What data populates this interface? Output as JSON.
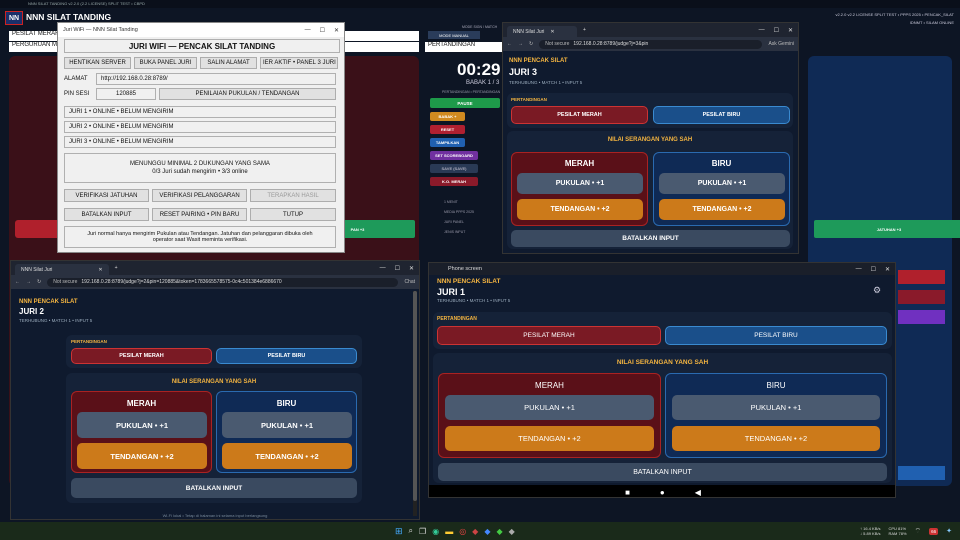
{
  "colors": {
    "red": "#7a1a24",
    "blue": "#1a4f8a",
    "orange": "#cc7a1a",
    "grey": "#4a5a70",
    "green": "#1e8a4a"
  },
  "bg": {
    "title": "NNN SILAT TANDING v2.2.0 (2.2 LICENSE) SPLIT TEST • CBPD",
    "top_right": "v2.2.0 v2.2 LICENSE SPLIT TEST • PPPS 2025 • PENCAK_SILAT",
    "top_right2": "IDNMT • SILAM ONLINE",
    "left_field1": "PESILAT MERAH",
    "left_field2": "PERGURUAN MERAH",
    "mid_field": "PERTANDINGAN",
    "mid_small": "MODE SIGN / MATCH",
    "mode_manual": "MODE MANUAL",
    "timer": "00:29",
    "babak": "BABAK 1 / 3",
    "pertandingan_lbl": "PERTANDINGAN • PERTANDINGAN",
    "btn_pause": "PAUSE",
    "btn_babak": "BABAK +",
    "btn_reset": "RESET",
    "btn_tampilkan": "TAMPILKAN",
    "btn_set_scoreboard": "SET SCOREBOARD",
    "btn_save": "SAVE (SAVE)",
    "btn_kmerah": "K.O. MERAH",
    "small1": "1 MENIT",
    "small2": "MEDIA PPPS 2025",
    "small3": "JURI PANEL",
    "small4": "JENIS INPUT",
    "btn_left_red": "",
    "btn_right_green": "JATUHAN +3",
    "btn_center_green": "PAN +3"
  },
  "juri_wifi": {
    "title": "Juri WiFi — NNN Silat Tanding",
    "heading": "JURI WIFI — PENCAK SILAT TANDING",
    "btn_stop": "HENTIKAN SERVER",
    "btn_open": "BUKA PANEL JURI",
    "btn_copy": "SALIN ALAMAT",
    "btn_panel3": "IER AKTIF • PANEL 3 JURI",
    "alamat_label": "ALAMAT",
    "alamat_value": "http://192.168.0.28:8789/",
    "pin_label": "PIN SESI",
    "pin_value": "120885",
    "btn_scoring": "PENILAIAN PUKULAN / TENDANGAN",
    "juri1": "JURI 1 • ONLINE • BELUM MENGIRIM",
    "juri2": "JURI 2 • ONLINE • BELUM MENGIRIM",
    "juri3": "JURI 3 • ONLINE • BELUM MENGIRIM",
    "status1": "MENUNGGU MINIMAL 2 DUKUNGAN YANG SAMA",
    "status2": "0/3 Juri sudah mengirim • 3/3 online",
    "btn_verif_jatuhan": "VERIFIKASI JATUHAN",
    "btn_verif_pelanggaran": "VERIFIKASI PELANGGARAN",
    "btn_terapkan": "TERAPKAN HASIL",
    "btn_batalkan": "BATALKAN INPUT",
    "btn_reset_pin": "RESET PAIRING • PIN BARU",
    "btn_tutup": "TUTUP",
    "note1": "Juri normal hanya mengirim Pukulan atau Tendangan. Jatuhan dan pelanggaran dibuka oleh",
    "note2": "operator saat Wasit meminta verifikasi."
  },
  "juri3": {
    "tab": "NNN Silat Juri",
    "not_secure": "Not secure",
    "url": "192.168.0.28:8789/judge?j=3&pin",
    "ask": "Ask Gemini",
    "brand": "NNN PENCAK SILAT",
    "title": "JURI 3",
    "sub": "TERHUBUNG • MATCH 1 • INPUT 5",
    "pertandingan": "PERTANDINGAN",
    "pesilat_merah": "PESILAT MERAH",
    "pesilat_biru": "PESILAT BIRU",
    "nilai": "NILAI SERANGAN YANG SAH",
    "merah": "MERAH",
    "biru": "BIRU",
    "pukulan": "PUKULAN • +1",
    "tendangan": "TENDANGAN • +2",
    "batalkan": "BATALKAN INPUT"
  },
  "juri2": {
    "tab": "NNN Silat Juri",
    "not_secure": "Not secure",
    "url": "192.168.0.28:8789/judge?j=2&pin=120885&token=1783665578575-0c4c501384e6886670",
    "chat": "Chat",
    "brand": "NNN PENCAK SILAT",
    "title": "JURI 2",
    "sub": "TERHUBUNG • MATCH 1 • INPUT 5",
    "pertandingan": "PERTANDINGAN",
    "pesilat_merah": "PESILAT MERAH",
    "pesilat_biru": "PESILAT BIRU",
    "nilai": "NILAI SERANGAN YANG SAH",
    "merah": "MERAH",
    "biru": "BIRU",
    "pukulan": "PUKULAN • +1",
    "tendangan": "TENDANGAN • +2",
    "batalkan": "BATALKAN INPUT",
    "footer": "Wi-Fi lokal • Tetap di halaman ini selama input berlangsung"
  },
  "juri1": {
    "title": "Phone screen",
    "brand": "NNN PENCAK SILAT",
    "heading": "JURI 1",
    "sub": "TERHUBUNG • MATCH 1 • INPUT 5",
    "pertandingan": "PERTANDINGAN",
    "pesilat_merah": "PESILAT MERAH",
    "pesilat_biru": "PESILAT BIRU",
    "nilai": "NILAI SERANGAN YANG SAH",
    "merah": "MERAH",
    "biru": "BIRU",
    "pukulan": "PUKULAN • +1",
    "tendangan": "TENDANGAN • +2",
    "batalkan": "BATALKAN INPUT"
  },
  "taskbar": {
    "net1": "↑ 16.4 KB/s",
    "net2": "↓ 5.89 KB/s",
    "cpu": "CPU 81%",
    "ram": "RAM 78%",
    "badge": "66"
  }
}
